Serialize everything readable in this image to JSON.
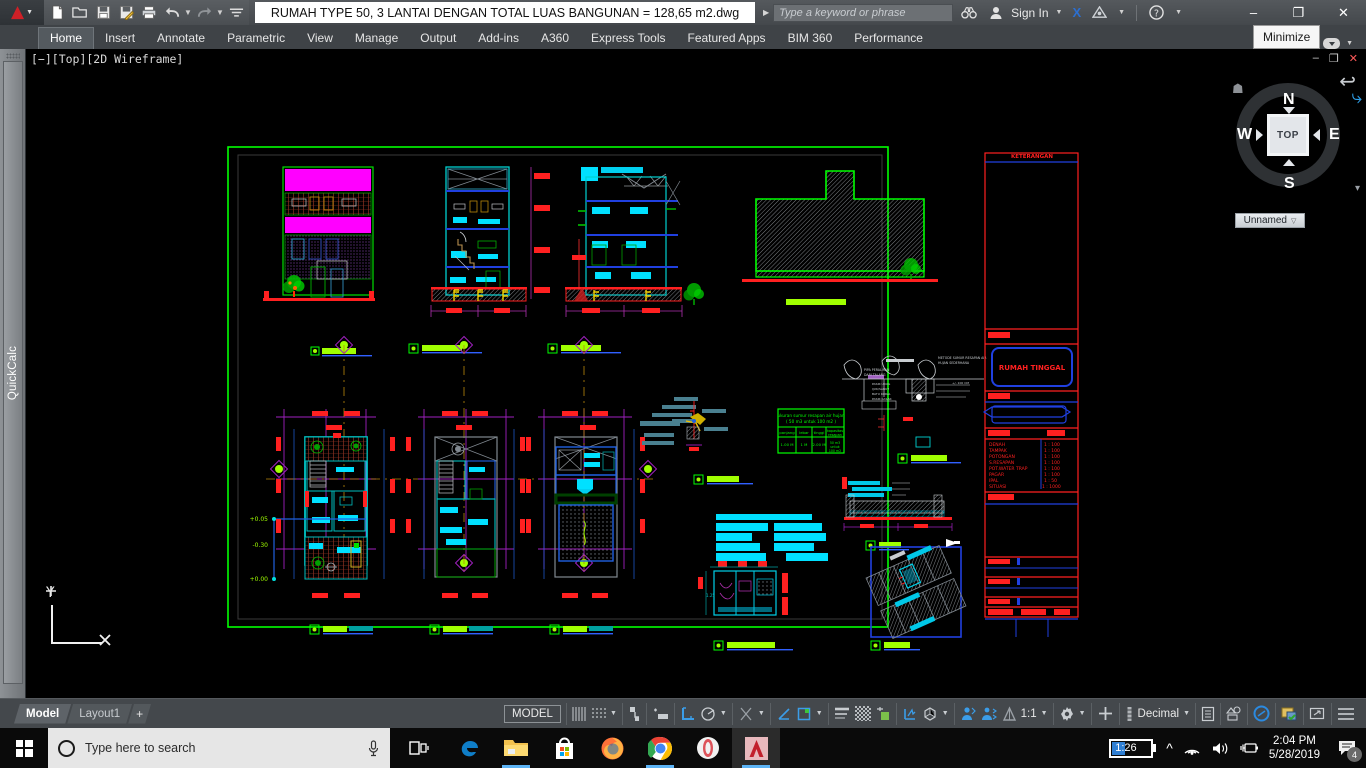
{
  "window": {
    "title": "RUMAH TYPE 50, 3 LANTAI DENGAN TOTAL LUAS BANGUNAN = 128,65 m2.dwg",
    "minimize_label": "–",
    "maximize_label": "❐",
    "close_label": "✕",
    "tooltip": "Minimize"
  },
  "quick_access": {
    "items": [
      {
        "name": "new-file",
        "glyph": "🗋"
      },
      {
        "name": "open-file",
        "glyph": "📂"
      },
      {
        "name": "save-file",
        "glyph": "💾"
      },
      {
        "name": "save-as-file",
        "glyph": "📝"
      },
      {
        "name": "plot",
        "glyph": "🖨"
      },
      {
        "name": "undo",
        "glyph": "↶"
      },
      {
        "name": "undo-dropdown",
        "glyph": "▾"
      },
      {
        "name": "redo",
        "glyph": "↷"
      },
      {
        "name": "redo-dropdown",
        "glyph": "▾"
      },
      {
        "name": "qat-customize",
        "glyph": "≡"
      }
    ]
  },
  "search": {
    "placeholder": "Type a keyword or phrase",
    "binoculars_glyph": "🔭",
    "account_glyph": "👤",
    "sign_in_label": "Sign In",
    "exchange_glyph": "X",
    "autodesk_glyph": "△",
    "help_glyph": "?"
  },
  "ribbon": {
    "tabs": [
      {
        "label": "Home",
        "active": true
      },
      {
        "label": "Insert",
        "active": false
      },
      {
        "label": "Annotate",
        "active": false
      },
      {
        "label": "Parametric",
        "active": false
      },
      {
        "label": "View",
        "active": false
      },
      {
        "label": "Manage",
        "active": false
      },
      {
        "label": "Output",
        "active": false
      },
      {
        "label": "Add-ins",
        "active": false
      },
      {
        "label": "A360",
        "active": false
      },
      {
        "label": "Express Tools",
        "active": false
      },
      {
        "label": "Featured Apps",
        "active": false
      },
      {
        "label": "BIM 360",
        "active": false
      },
      {
        "label": "Performance",
        "active": false
      }
    ]
  },
  "left_panel": {
    "label": "QuickCalc"
  },
  "viewport": {
    "label": "[−][Top][2D Wireframe]",
    "minimize_glyph": "–",
    "maximize_glyph": "❐",
    "close_glyph": "✕"
  },
  "navcube": {
    "top_label": "TOP",
    "north": "N",
    "south": "S",
    "west": "W",
    "east": "E",
    "home_glyph": "⌂",
    "view_name": "Unnamed",
    "dropdown_glyph": "▽"
  },
  "drawing": {
    "sheet_border_color": "#00ff00",
    "title_block": {
      "keterangan_header": "KETERANGAN",
      "project_name": "RUMAH TINGGAL",
      "scale_header_left": "",
      "scale_header_right": "",
      "scales": [
        {
          "item": "DENAH",
          "value": "1 : 100"
        },
        {
          "item": "TAMPAK",
          "value": "1 : 100"
        },
        {
          "item": "POTONGAN",
          "value": "1 : 100"
        },
        {
          "item": "S.RESAPAN",
          "value": "1 : 100"
        },
        {
          "item": "POT.WATER TRAP",
          "value": "1 : 100"
        },
        {
          "item": "PAGAR",
          "value": "1 : 100"
        },
        {
          "item": "IPAL",
          "value": "1 : 50"
        },
        {
          "item": "SITUASI",
          "value": "1 : 1000"
        }
      ]
    },
    "view_labels": [
      {
        "id": "tampak-depan",
        "text": "TAMPAK DEPAN"
      },
      {
        "id": "potongan-aa",
        "text": "POTONGAN A-A"
      },
      {
        "id": "potongan-bb",
        "text": "POTONGAN B-B"
      },
      {
        "id": "denah-lantai-1",
        "text": "DENAH LANTAI 1"
      },
      {
        "id": "denah-lantai-2",
        "text": "DENAH LANTAI 2"
      },
      {
        "id": "denah-lantai-3",
        "text": "DENAH LANTAI 3"
      },
      {
        "id": "pot-water-trap",
        "text": "POT. WATER TRAP"
      },
      {
        "id": "sumur-resapan",
        "text": "SUMUR RESAPAN"
      },
      {
        "id": "pagar",
        "text": "PAGAR"
      },
      {
        "id": "ipal",
        "text": "POT. IPAL / SEPTICTANK"
      },
      {
        "id": "situasi",
        "text": "SITUASI"
      }
    ],
    "level_marks": [
      "+0.05",
      "-0.30",
      "+0.00"
    ]
  },
  "statusbar": {
    "layout_tabs": [
      {
        "label": "Model",
        "active": true
      },
      {
        "label": "Layout1",
        "active": false
      },
      {
        "label": "+",
        "active": false
      }
    ],
    "model_button": "MODEL",
    "scale_label": "1:1",
    "units_label": "Decimal",
    "tools": [
      {
        "name": "grid-display",
        "glyph": "▒"
      },
      {
        "name": "snap-mode",
        "glyph": "∷"
      },
      {
        "name": "snap-dropdown",
        "glyph": "▾"
      },
      {
        "name": "infer-constraints",
        "glyph": "⌐"
      },
      {
        "name": "dynamic-input",
        "glyph": "⇥"
      },
      {
        "name": "ortho-mode",
        "glyph": "∟"
      },
      {
        "name": "polar-tracking",
        "glyph": "⌀"
      },
      {
        "name": "polar-dropdown",
        "glyph": "▾"
      },
      {
        "name": "isometric-drafting",
        "glyph": "✕"
      },
      {
        "name": "iso-dropdown",
        "glyph": "▾"
      },
      {
        "name": "object-snap-tracking",
        "glyph": "∠"
      },
      {
        "name": "object-snap",
        "glyph": "□"
      },
      {
        "name": "osnap-dropdown",
        "glyph": "▾"
      },
      {
        "name": "lineweight",
        "glyph": "≡"
      },
      {
        "name": "transparency",
        "glyph": "░"
      },
      {
        "name": "selection-cycling",
        "glyph": "⊞"
      },
      {
        "name": "3d-object-snap",
        "glyph": "⋔"
      },
      {
        "name": "dynamic-ucs",
        "glyph": "⬚"
      },
      {
        "name": "ucs-dropdown",
        "glyph": "▾"
      },
      {
        "name": "annotation-visibility",
        "glyph": "👤"
      },
      {
        "name": "autoscale",
        "glyph": "👥"
      },
      {
        "name": "annotation-scale-icon",
        "glyph": "△"
      },
      {
        "name": "workspace-switching",
        "glyph": "⚙"
      },
      {
        "name": "workspace-dropdown",
        "glyph": "▾"
      },
      {
        "name": "annotation-monitor",
        "glyph": "＋"
      },
      {
        "name": "units-icon",
        "glyph": "▮"
      },
      {
        "name": "units-dropdown",
        "glyph": "▾"
      },
      {
        "name": "quick-properties",
        "glyph": "▤"
      },
      {
        "name": "isolate-objects",
        "glyph": "◳"
      },
      {
        "name": "graphics-performance",
        "glyph": "⊘"
      },
      {
        "name": "clean-screen",
        "glyph": "❐"
      },
      {
        "name": "fullscreen-toggle",
        "glyph": "⤡"
      },
      {
        "name": "customization",
        "glyph": "≡"
      }
    ]
  },
  "taskbar": {
    "search_placeholder": "Type here to search",
    "apps": [
      {
        "name": "task-view",
        "label": ""
      },
      {
        "name": "microsoft-edge",
        "label": "e"
      },
      {
        "name": "file-explorer",
        "label": ""
      },
      {
        "name": "microsoft-store",
        "label": ""
      },
      {
        "name": "mozilla-firefox",
        "label": ""
      },
      {
        "name": "google-chrome",
        "label": ""
      },
      {
        "name": "opera-browser",
        "label": ""
      },
      {
        "name": "autocad",
        "label": ""
      }
    ],
    "battery_percent": "1:26",
    "time": "2:04 PM",
    "date": "5/28/2019",
    "notification_count": "4"
  }
}
